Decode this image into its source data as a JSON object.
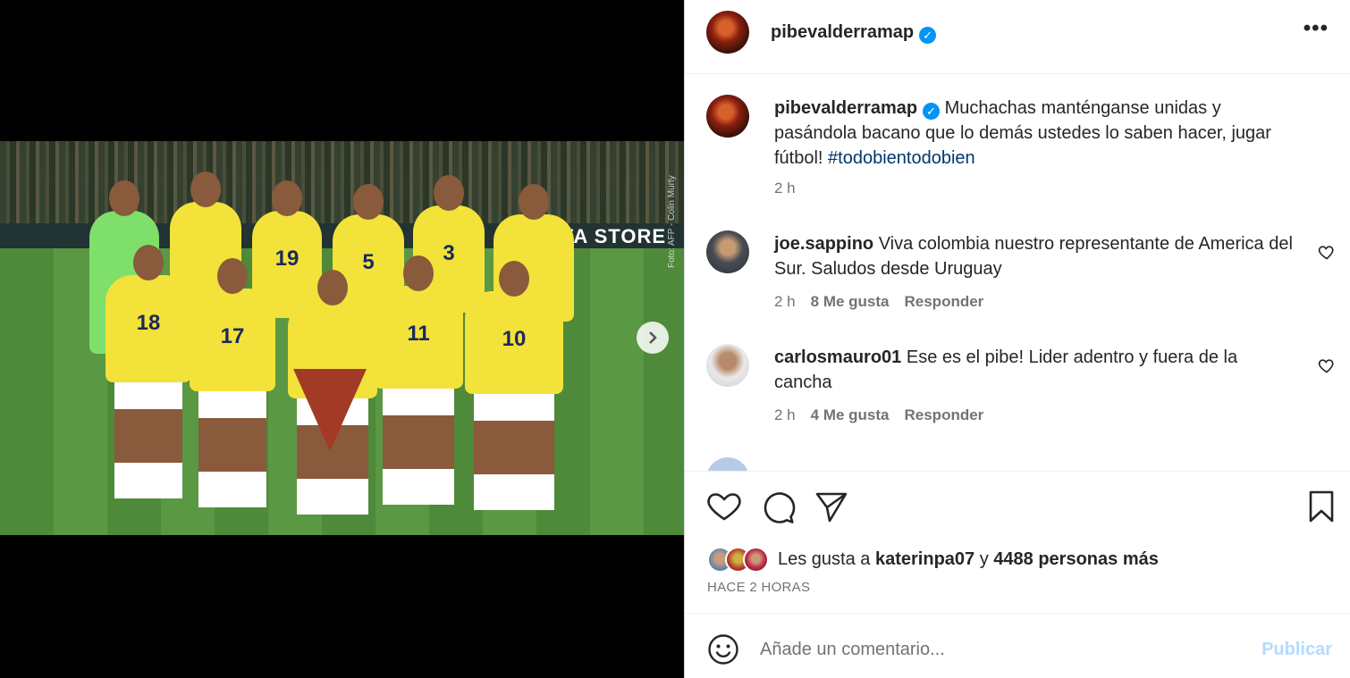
{
  "media": {
    "board_text": "FA STORE",
    "credit": "Foto: AFP - Colin Murty",
    "jerseys": [
      "19",
      "5",
      "3",
      "18",
      "17",
      "11",
      "10"
    ],
    "next_icon": "chevron-right-icon",
    "carousel_total": 2,
    "carousel_active": 1
  },
  "header": {
    "username": "pibevalderramap",
    "verified_icon": "verified-badge-icon",
    "more_icon": "more-icon"
  },
  "caption": {
    "username": "pibevalderramap",
    "text": "Muchachas manténganse unidas y pasándola bacano que lo demás ustedes lo saben hacer, jugar fútbol! ",
    "hashtag": "#todobientodobien",
    "time": "2 h"
  },
  "comments": [
    {
      "username": "joe.sappino",
      "text": "Viva colombia nuestro representante de America del Sur. Saludos desde Uruguay",
      "time": "2 h",
      "likes": "8 Me gusta",
      "reply": "Responder"
    },
    {
      "username": "carlosmauro01",
      "text": "Ese es el pibe! Lider adentro y fuera de la cancha",
      "time": "2 h",
      "likes": "4 Me gusta",
      "reply": "Responder"
    }
  ],
  "likes": {
    "prefix": "Les gusta a",
    "user": "katerinpa07",
    "middle": "y",
    "others": "4488 personas más"
  },
  "post_time": "HACE 2 HORAS",
  "comment_box": {
    "placeholder": "Añade un comentario...",
    "publish_label": "Publicar"
  },
  "colors": {
    "accent": "#0095f6",
    "publish_disabled": "#b3dbff",
    "hashtag": "#00376b",
    "secondary_text": "#737373"
  }
}
